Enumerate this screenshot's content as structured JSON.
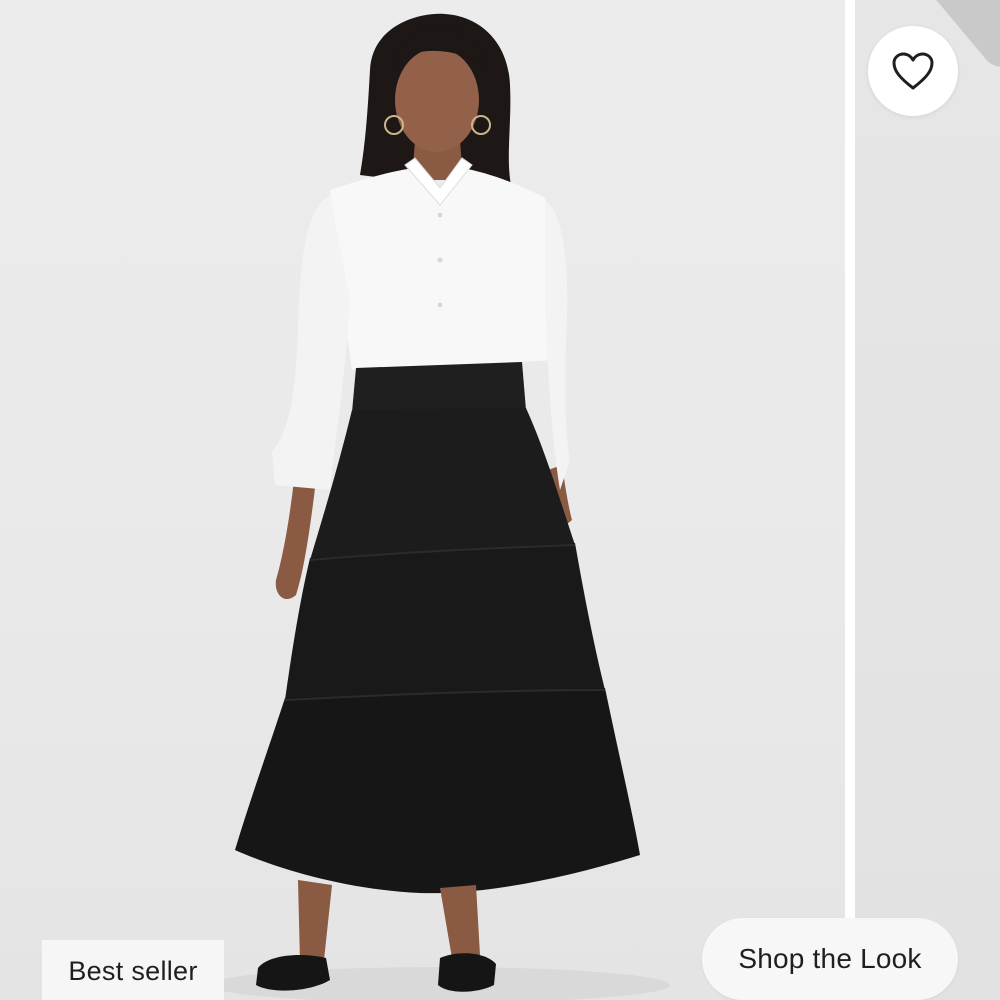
{
  "product_card": {
    "badge_label": "Best seller",
    "shop_look_label": "Shop the Look",
    "favorite_icon": "heart-outline-icon",
    "photo_description_icon": "product-photo"
  },
  "colors": {
    "background": "#e9e9e9",
    "skirt": "#1c1c1c",
    "shirt": "#f8f8f8",
    "button_bg": "#f7f7f7",
    "text": "#1f1f1f"
  }
}
